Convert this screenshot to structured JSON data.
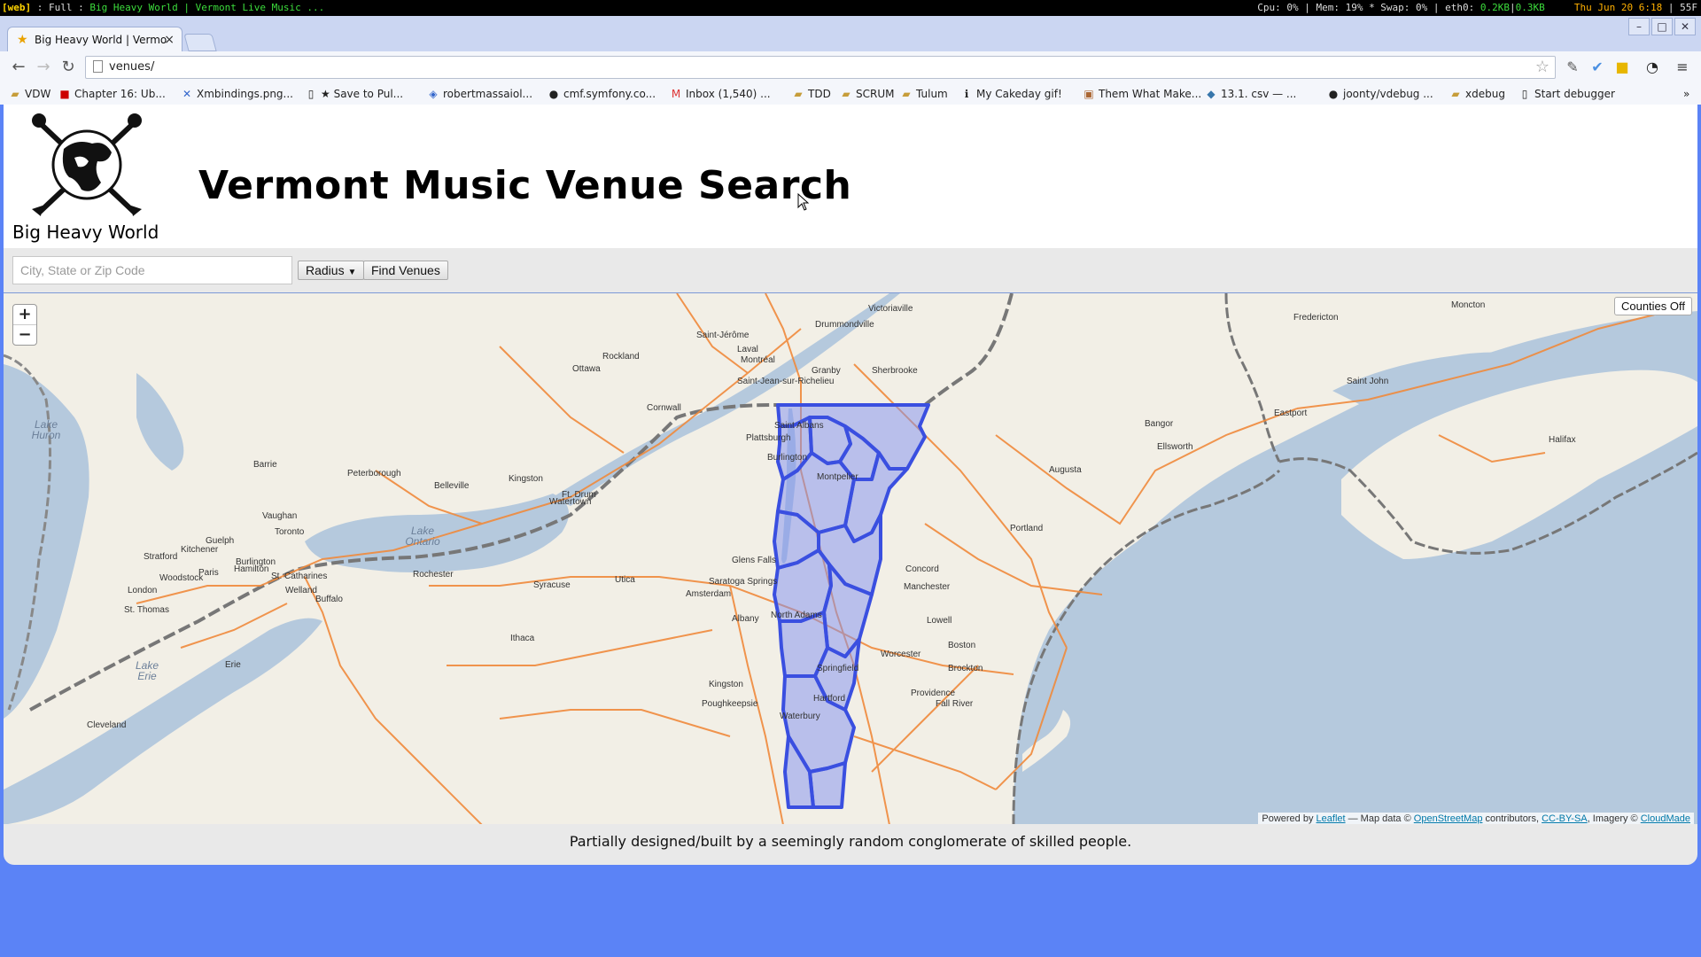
{
  "wm": {
    "tag": "[web]",
    "layout": ": Full :",
    "title": "Big Heavy World | Vermont Live Music ...",
    "stats": "Cpu: 0% | Mem: 19% * Swap: 0% | eth0:",
    "net_down": "0.2KB",
    "net_sep": "|",
    "net_up": "0.3KB",
    "date": "Thu Jun 20  6:18",
    "extra": "|  55F"
  },
  "browser": {
    "tab_title": "Big Heavy World | Vermo",
    "tab_close": "×",
    "url": "venues/",
    "window_buttons": [
      "–",
      "□",
      "✕"
    ]
  },
  "bookmarks": [
    {
      "label": "VDW",
      "icon": "folder"
    },
    {
      "label": "Chapter 16: Ub...",
      "icon": "lj"
    },
    {
      "label": "Xmbindings.png...",
      "icon": "x"
    },
    {
      "label": "★ Save to Pul...",
      "icon": "page"
    },
    {
      "label": "robertmassaiol...",
      "icon": "shield"
    },
    {
      "label": "cmf.symfony.co...",
      "icon": "sf"
    },
    {
      "label": "Inbox (1,540) ...",
      "icon": "gmail"
    },
    {
      "label": "TDD",
      "icon": "folder"
    },
    {
      "label": "SCRUM",
      "icon": "folder"
    },
    {
      "label": "Tulum",
      "icon": "folder"
    },
    {
      "label": "My Cakeday gif!",
      "icon": "info"
    },
    {
      "label": "Them What Make...",
      "icon": "img"
    },
    {
      "label": "13.1. csv — ...",
      "icon": "py"
    },
    {
      "label": "joonty/vdebug ...",
      "icon": "gh"
    },
    {
      "label": "xdebug",
      "icon": "folder"
    },
    {
      "label": "Start debugger",
      "icon": "page"
    }
  ],
  "site": {
    "brand": "Big Heavy World",
    "title": "Vermont Music Venue Search"
  },
  "search": {
    "placeholder": "City, State or Zip Code",
    "radius_label": "Radius",
    "find_label": "Find Venues"
  },
  "map": {
    "zoom_in": "+",
    "zoom_out": "−",
    "counties_toggle": "Counties Off",
    "attribution": {
      "powered": "Powered by",
      "leaflet": "Leaflet",
      "mapdata": "— Map data ©",
      "osm": "OpenStreetMap",
      "contrib": "contributors,",
      "license": "CC-BY-SA",
      "imagery": ", Imagery ©",
      "cloudmade": "CloudMade"
    },
    "cities": [
      "Victoriaville",
      "Drummondville",
      "Saint-Jérôme",
      "Laval",
      "Montréal",
      "Rockland",
      "Ottawa",
      "Granby",
      "Sherbrooke",
      "Saint-Jean-sur-Richelieu",
      "Cornwall",
      "Saint Albans",
      "Plattsburgh",
      "Burlington",
      "Montpelier",
      "Barrie",
      "Peterborough",
      "Belleville",
      "Kingston",
      "Ft. Drum",
      "Watertown",
      "Vaughan",
      "Toronto",
      "Guelph",
      "Kitchener",
      "Stratford",
      "Paris",
      "Burlington",
      "Hamilton",
      "Woodstock",
      "St. Catharines",
      "Welland",
      "Buffalo",
      "London",
      "St. Thomas",
      "Rochester",
      "Syracuse",
      "Utica",
      "Glens Falls",
      "Saratoga Springs",
      "Amsterdam",
      "Albany",
      "North Adams",
      "Ithaca",
      "Erie",
      "Kingston",
      "Poughkeepsie",
      "Springfield",
      "Hartford",
      "Waterbury",
      "Worcester",
      "Providence",
      "Fall River",
      "Brockton",
      "Boston",
      "Lowell",
      "Manchester",
      "Concord",
      "Portland",
      "Augusta",
      "Bangor",
      "Ellsworth",
      "Eastport",
      "Fredericton",
      "Moncton",
      "Saint John",
      "Halifax",
      "Cleveland"
    ],
    "water": [
      "Lake Huron",
      "Lake Ontario",
      "Lake Erie"
    ],
    "colors": {
      "land": "#f2efe6",
      "water": "#b5c9dd",
      "roads": "#f08a3c",
      "border": "#777777",
      "counties_fill": "#7f8ff0",
      "counties_stroke": "#3a4fe0"
    }
  },
  "footer": {
    "text": "Partially designed/built by a seemingly random conglomerate of skilled people."
  }
}
